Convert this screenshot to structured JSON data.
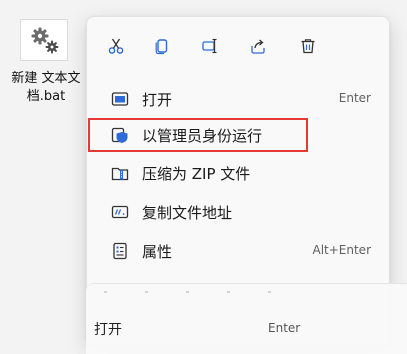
{
  "desktop_file": {
    "name_line1": "新建 文本文",
    "name_line2": "档.bat"
  },
  "menu": {
    "quick_actions": [
      {
        "icon": "cut-icon"
      },
      {
        "icon": "copy-icon"
      },
      {
        "icon": "rename-icon"
      },
      {
        "icon": "share-icon"
      },
      {
        "icon": "delete-icon"
      }
    ],
    "items": [
      {
        "label": "打开",
        "shortcut": "Enter",
        "icon": "open-icon"
      },
      {
        "label": "以管理员身份运行",
        "shortcut": "",
        "icon": "shield-icon"
      },
      {
        "label": "压缩为 ZIP 文件",
        "shortcut": "",
        "icon": "zip-icon"
      },
      {
        "label": "复制文件地址",
        "shortcut": "",
        "icon": "copy-path-icon"
      },
      {
        "label": "属性",
        "shortcut": "Alt+Enter",
        "icon": "properties-icon"
      }
    ]
  },
  "ghost_menu": {
    "label": "打开",
    "shortcut": "Enter"
  },
  "colors": {
    "accent": "#1a73e8",
    "highlight_border": "#e53935"
  }
}
